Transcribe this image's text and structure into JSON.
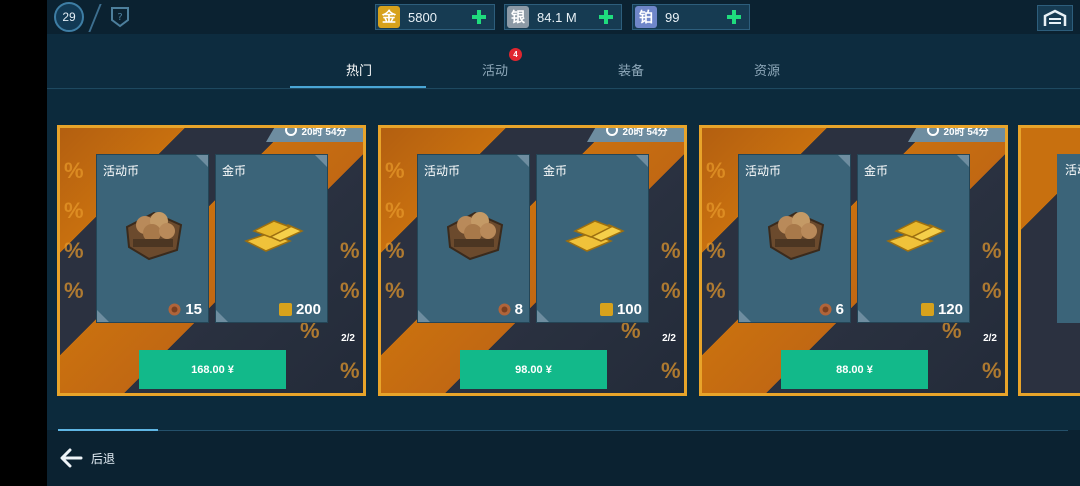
{
  "player": {
    "level": "29"
  },
  "currencies": [
    {
      "icon": "gold-icon",
      "glyph": "金",
      "value": "5800",
      "color": "#d7a21c"
    },
    {
      "icon": "silver-icon",
      "glyph": "银",
      "value": "84.1 M",
      "color": "#8d9aa6"
    },
    {
      "icon": "platinum-icon",
      "glyph": "铂",
      "value": "99",
      "color": "#6f86c9"
    }
  ],
  "tabs": [
    {
      "label": "热门",
      "active": true
    },
    {
      "label": "活动",
      "badge": "4"
    },
    {
      "label": "装备"
    },
    {
      "label": "资源"
    }
  ],
  "offers": [
    {
      "timer": "20时 54分",
      "items": [
        {
          "title": "活动币",
          "amount": "15"
        },
        {
          "title": "金币",
          "amount": "200"
        }
      ],
      "stock": "2/2",
      "price": "168.00 ¥"
    },
    {
      "timer": "20时 54分",
      "items": [
        {
          "title": "活动币",
          "amount": "8"
        },
        {
          "title": "金币",
          "amount": "100"
        }
      ],
      "stock": "2/2",
      "price": "98.00 ¥"
    },
    {
      "timer": "20时 54分",
      "items": [
        {
          "title": "活动币",
          "amount": "6"
        },
        {
          "title": "金币",
          "amount": "120"
        }
      ],
      "stock": "2/2",
      "price": "88.00 ¥"
    },
    {
      "items": [
        {
          "title": "活动"
        }
      ]
    }
  ],
  "colors": {
    "accent_border": "#e8a42a",
    "buy_button": "#12b98a",
    "plus": "#1fdc7d",
    "badge": "#e0262f"
  },
  "footer": {
    "back_label": "后退"
  }
}
